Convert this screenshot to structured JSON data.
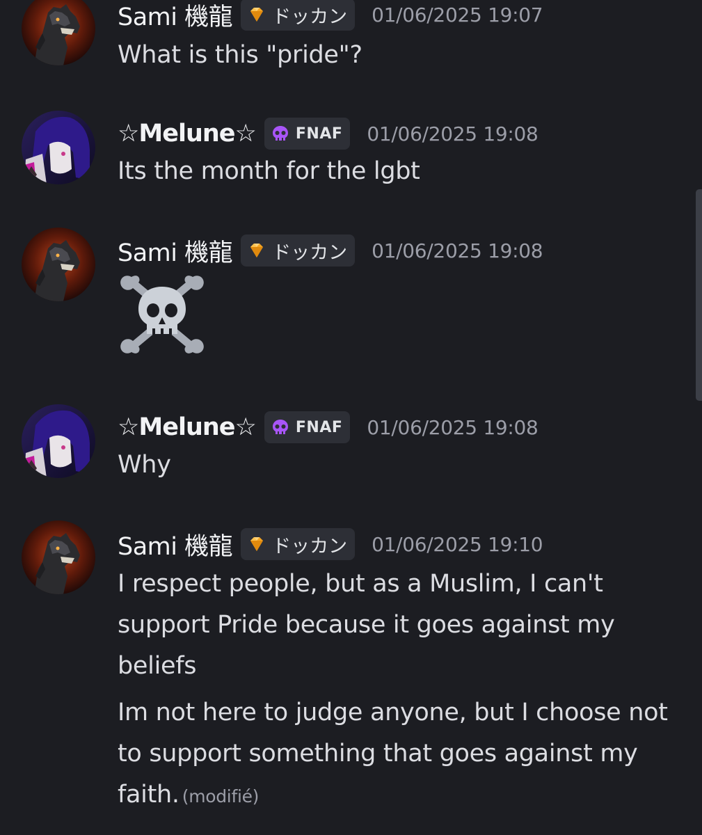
{
  "messages": [
    {
      "author": "Sami 機龍",
      "tag": "ドッカン",
      "timestamp": "01/06/2025 19:07",
      "lines": [
        "What is this \"pride\"?"
      ]
    },
    {
      "author": "☆Melune☆",
      "tag": "FNAF",
      "timestamp": "01/06/2025 19:08",
      "lines": [
        "Its the month for the lgbt"
      ]
    },
    {
      "author": "Sami 機龍",
      "tag": "ドッカン",
      "timestamp": "01/06/2025 19:08",
      "emoji": "skull-and-crossbones"
    },
    {
      "author": "☆Melune☆",
      "tag": "FNAF",
      "timestamp": "01/06/2025 19:08",
      "lines": [
        "Why"
      ]
    },
    {
      "author": "Sami 機龍",
      "tag": "ドッカン",
      "timestamp": "01/06/2025 19:10",
      "lines": [
        "I respect people, but as a Muslim, I can't support Pride because it goes against my beliefs",
        "Im not here to judge anyone, but I choose not to support something that goes against my faith."
      ],
      "edited_label": "(modifié)"
    }
  ],
  "icons": {
    "sami_tag_icon": "orange-diamond-gem-icon",
    "melune_tag_icon": "purple-skull-icon",
    "emoji": "skull-and-crossbones-emoji"
  },
  "colors": {
    "background": "#1c1d22",
    "username": "#f2f3f5",
    "message_text": "#dcdde2",
    "timestamp": "#9c9ea8",
    "tag_background": "#2d2f36",
    "sami_gem": "#f5a623",
    "melune_skull": "#a855f7"
  }
}
